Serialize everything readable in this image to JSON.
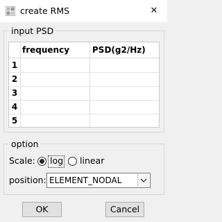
{
  "window": {
    "title": "create RMS",
    "close_glyph": "✕"
  },
  "input_psd": {
    "group_title": "input PSD",
    "columns": [
      "frequency",
      "PSD(g2/Hz)"
    ],
    "rows": [
      {
        "num": "1",
        "frequency": "",
        "psd": ""
      },
      {
        "num": "2",
        "frequency": "",
        "psd": ""
      },
      {
        "num": "3",
        "frequency": "",
        "psd": ""
      },
      {
        "num": "4",
        "frequency": "",
        "psd": ""
      },
      {
        "num": "5",
        "frequency": "",
        "psd": ""
      }
    ]
  },
  "option": {
    "group_title": "option",
    "scale_label": "Scale:",
    "scale_options": [
      {
        "label": "log",
        "checked": true
      },
      {
        "label": "linear",
        "checked": false
      }
    ],
    "position_label": "position:",
    "position_value": "ELEMENT_NODAL"
  },
  "buttons": {
    "ok": "OK",
    "cancel": "Cancel"
  },
  "icons": {
    "app": "grid-app-icon",
    "close": "close-icon",
    "dropdown": "chevron-down-icon"
  }
}
